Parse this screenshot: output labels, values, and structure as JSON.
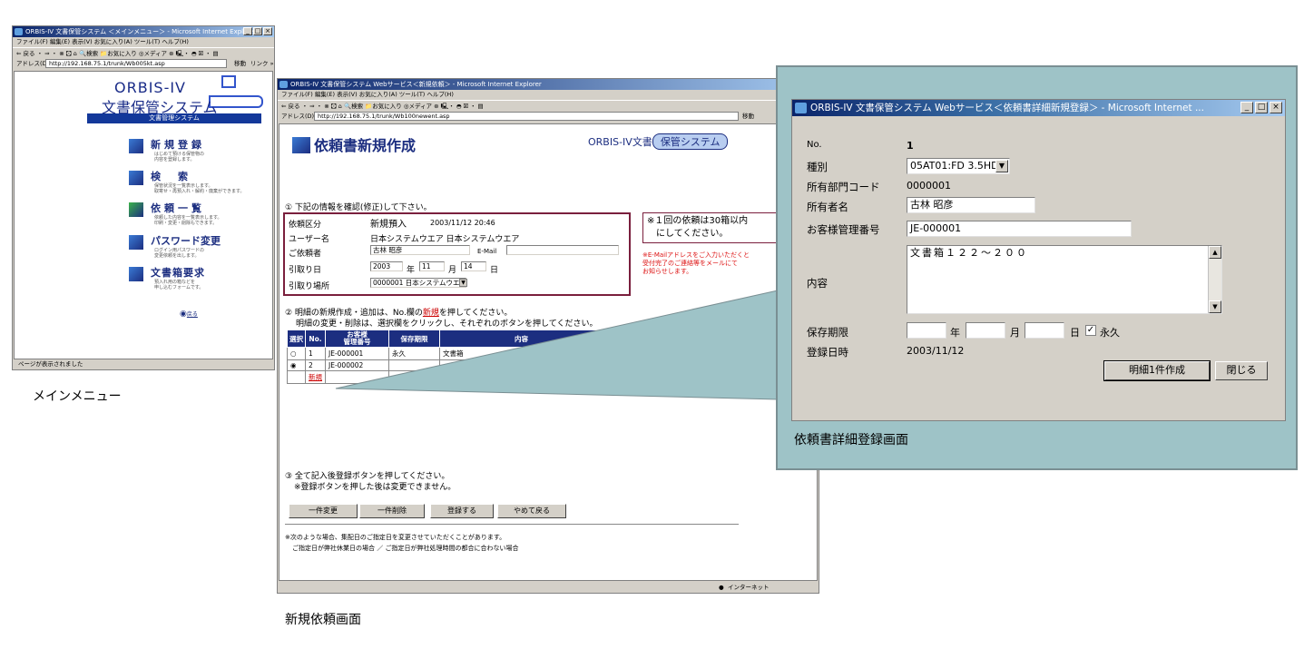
{
  "main_menu": {
    "title": "ORBIS-IV 文書保管システム ＜メインメニュー＞ - Microsoft Internet Explorer",
    "menu": "ファイル(F)   編集(E)   表示(V)   お気に入り(A)   ツール(T)   ヘルプ(H)",
    "toolbar": "⇐ 戻る ・ ⇒ ・ ⊗ 🖸 ⌂  🔍検索  📁お気に入り  ◎メディア  ⊛  🖳・ ◓ 🗵 ・ ▤",
    "address_label": "アドレス(D)",
    "address": "http://192.168.75.1/trunk/Wb005kt.asp",
    "go": "移動",
    "links": "リンク »",
    "logo_line1": "ORBIS-IV",
    "logo_line2": "文書保管システム",
    "subheader": "文書管理システム",
    "items": [
      {
        "label": "新規登録",
        "desc": "はじめて預ける保管物の\n内容を登録します。"
      },
      {
        "label": "検　索",
        "desc": "保管状況を一覧表示します。\n取寄せ・再預入れ・解約・廃棄ができます。"
      },
      {
        "label": "依頼一覧",
        "desc": "依頼した内容を一覧表示します。\n印刷・変更・削除もできます。"
      },
      {
        "label": "パスワード変更",
        "desc": "ログイン用パスワードの\n変更依頼を出します。"
      },
      {
        "label": "文書箱要求",
        "desc": "預入れ用の箱などを\n申し込むフォームです。"
      }
    ],
    "back": "戻る",
    "status": "ページが表示されました",
    "caption": "メインメニュー"
  },
  "new_request": {
    "title": "ORBIS-IV 文書保管システム Webサービス＜新規依頼＞ - Microsoft Internet Explorer",
    "menu": "ファイル(F)   編集(E)   表示(V)   お気に入り(A)   ツール(T)   ヘルプ(H)",
    "toolbar": "⇐ 戻る ・ ⇒ ・ ⊗  🖸  ⌂   🔍検索   📁お気に入り   ◎メディア   ⊛   🖳・ ◓  🗵 ・ ▤",
    "address_label": "アドレス(D)",
    "address": "http://192.168.75.1/trunk/Wb100newent.asp",
    "go": "移動",
    "heading": "依頼書新規作成",
    "brand": "ORBIS-IV文書",
    "brand_pill": "保管システム",
    "step1": "① 下記の情報を確認(修正)して下さい。",
    "request_type_label": "依頼区分",
    "request_type": "新規預入",
    "request_datetime": "2003/11/12 20:46",
    "user_label": "ユーザー名",
    "user": "日本システムウエア 日本システムウエア",
    "requester_label": "ご依頼者",
    "requester": "古林 昭彦",
    "email_label": "E-Mail",
    "email": "",
    "pickup_date_label": "引取り日",
    "pickup_year": "2003",
    "year_unit": "年",
    "pickup_month": "11",
    "month_unit": "月",
    "pickup_day": "14",
    "day_unit": "日",
    "pickup_place_label": "引取り場所",
    "pickup_place": "0000001 日本システムウエア",
    "note1": "※１回の依頼は30箱以内\n　にしてください。",
    "note2": "※E-Mailアドレスをご入力いただくと\n受付完了のご連絡等をメールにて\nお知らせします。",
    "step2_a": "② 明細の新規作成・追加は、No.欄の",
    "step2_link": "新規",
    "step2_b": "を押してください。",
    "step2_c": "明細の変更・削除は、選択欄をクリックし、それぞれのボタンを押してください。",
    "table_headers": [
      "選択",
      "No.",
      "お客様\n管理番号",
      "保存期限",
      "内容"
    ],
    "rows": [
      {
        "no": "1",
        "mgmt": "JE-000001",
        "period": "永久",
        "content": "文書箱"
      },
      {
        "no": "2",
        "mgmt": "JE-000002",
        "period": "",
        "content": ""
      }
    ],
    "new_link": "新規",
    "step3_a": "③ 全て記入後登録ボタンを押してください。",
    "step3_b": "※登録ボタンを押した後は変更できません。",
    "buttons": [
      "一件変更",
      "一件削除",
      "登録する",
      "やめて戻る"
    ],
    "footnote_a": "※次のような場合、集配日のご指定日を変更させていただくことがあります。",
    "footnote_b": "ご指定日が弊社休業日の場合 ／ ご指定日が弊社処理時間の都合に合わない場合",
    "status": "インターネット",
    "caption": "新規依頼画面"
  },
  "detail": {
    "title": "ORBIS-IV 文書保管システム Webサービス＜依頼書詳細新規登録＞ - Microsoft Internet ...",
    "no_label": "No.",
    "no": "1",
    "kind_label": "種別",
    "kind": "05AT01:FD 3.5HD",
    "dept_label": "所有部門コード",
    "dept": "0000001",
    "owner_label": "所有者名",
    "owner": "古林 昭彦",
    "mgmt_label": "お客様管理番号",
    "mgmt": "JE-000001",
    "content_label": "内容",
    "content": "文書箱１２２～２００",
    "period_label": "保存期限",
    "year_unit": "年",
    "month_unit": "月",
    "day_unit": "日",
    "permanent": "永久",
    "date_label": "登録日時",
    "date": "2003/11/12",
    "create_button": "明細1件作成",
    "close_button": "閉じる",
    "caption": "依頼書詳細登録画面"
  }
}
